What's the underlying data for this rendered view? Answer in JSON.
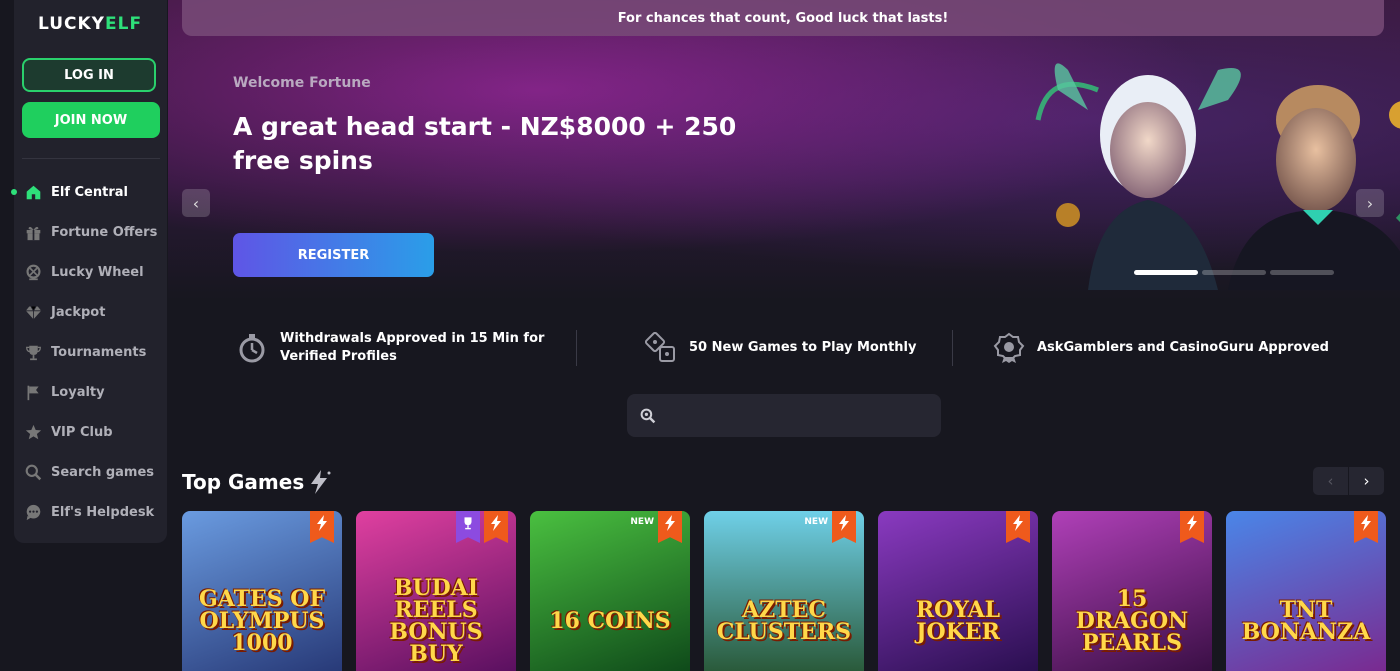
{
  "brand": {
    "logo_part1": "LUCKY",
    "logo_part2": "ELF"
  },
  "auth": {
    "login_label": "LOG IN",
    "join_label": "JOIN NOW"
  },
  "sidebar": {
    "items": [
      {
        "label": "Elf Central",
        "icon": "home-icon",
        "active": true
      },
      {
        "label": "Fortune Offers",
        "icon": "gift-icon"
      },
      {
        "label": "Lucky Wheel",
        "icon": "wheel-icon"
      },
      {
        "label": "Jackpot",
        "icon": "diamond-icon"
      },
      {
        "label": "Tournaments",
        "icon": "trophy-icon"
      },
      {
        "label": "Loyalty",
        "icon": "flag-icon"
      },
      {
        "label": "VIP Club",
        "icon": "star-icon"
      },
      {
        "label": "Search games",
        "icon": "search-icon"
      },
      {
        "label": "Elf's Helpdesk",
        "icon": "chat-icon"
      }
    ]
  },
  "topbar": {
    "text": "For chances that count, Good luck that lasts!"
  },
  "hero": {
    "subtitle": "Welcome Fortune",
    "title": "A great head start - NZ$8000 + 250 free spins",
    "cta_label": "REGISTER",
    "prev_icon": "chevron-left-icon",
    "next_icon": "chevron-right-icon",
    "slide_count": 3,
    "active_slide": 1
  },
  "features": [
    {
      "icon": "stopwatch-icon",
      "text": "Withdrawals Approved in 15 Min for Verified Profiles"
    },
    {
      "icon": "dice-icon",
      "text": "50 New Games to Play Monthly"
    },
    {
      "icon": "award-badge-icon",
      "text": "AskGamblers and CasinoGuru Approved"
    }
  ],
  "search": {
    "placeholder": "",
    "value": ""
  },
  "top_games": {
    "title": "Top Games",
    "games": [
      {
        "name": "GATES OF OLYMPUS 1000",
        "badges": [
          "bolt"
        ],
        "colors": [
          "#4a7fd0",
          "#283a78"
        ]
      },
      {
        "name": "BUDAI REELS BONUS BUY",
        "badges": [
          "bolt",
          "trophy"
        ],
        "colors": [
          "#c0288a",
          "#5a1060"
        ]
      },
      {
        "name": "16 COINS",
        "badges": [
          "bolt",
          "new"
        ],
        "new_label": "NEW",
        "colors": [
          "#2e9a30",
          "#0f4a1a"
        ]
      },
      {
        "name": "AZTEC CLUSTERS",
        "badges": [
          "bolt",
          "new"
        ],
        "new_label": "NEW",
        "colors": [
          "#4fb6d6",
          "#2a5a3a"
        ]
      },
      {
        "name": "ROYAL JOKER",
        "badges": [
          "bolt"
        ],
        "colors": [
          "#6a2aa0",
          "#2a0f50"
        ]
      },
      {
        "name": "15 DRAGON PEARLS",
        "badges": [
          "bolt"
        ],
        "colors": [
          "#8a2a90",
          "#3a0f45"
        ]
      },
      {
        "name": "TNT BONANZA",
        "badges": [
          "bolt"
        ],
        "colors": [
          "#4a86e8",
          "#7a2a90"
        ]
      }
    ]
  }
}
